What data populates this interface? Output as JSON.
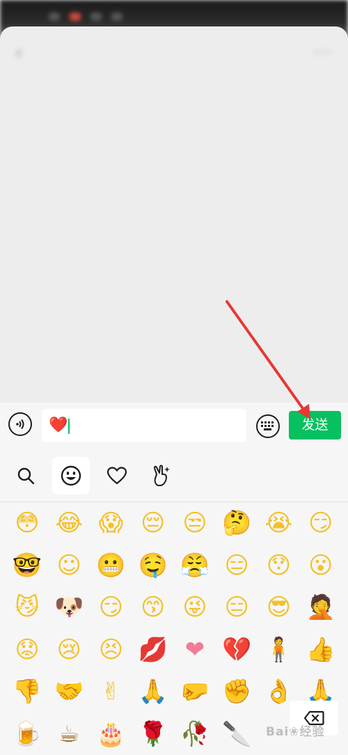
{
  "input": {
    "current_value": "❤️",
    "send_label": "发送"
  },
  "icons": {
    "voice": "voice-icon",
    "keyboard": "keyboard-icon",
    "delete": "backspace-icon"
  },
  "tabs": [
    {
      "name": "search",
      "icon": "search-icon",
      "active": false
    },
    {
      "name": "emoji",
      "icon": "smiley-icon",
      "active": true
    },
    {
      "name": "favorites",
      "icon": "heart-outline-icon",
      "active": false
    },
    {
      "name": "stickers",
      "icon": "victory-hand-icon",
      "active": false
    }
  ],
  "emoji_rows": [
    [
      "😳",
      "😂",
      "😱",
      "😔",
      "😒",
      "🤔",
      "😭",
      "😏"
    ],
    [
      "🤓",
      "☺",
      "😬",
      "🤤",
      "😤",
      "😑",
      "😯",
      "😮"
    ],
    [
      "😼",
      "🐶",
      "😏",
      "😙",
      "😜",
      "😑",
      "😎",
      "🤦"
    ],
    [
      "😟",
      "😢",
      "😣",
      "💋",
      "❤",
      "💔",
      "🧍",
      "👍"
    ],
    [
      "👎",
      "🤝",
      "✌",
      "🙏",
      "🤛",
      "✊",
      "👌",
      "🙏"
    ],
    [
      "🍺",
      "☕",
      "🎂",
      "🌹",
      "🥀",
      "🔪",
      "",
      ""
    ]
  ],
  "watermark": "Bai❀经验",
  "colors": {
    "send_button": "#07c160",
    "annotation_arrow": "#e53935"
  }
}
